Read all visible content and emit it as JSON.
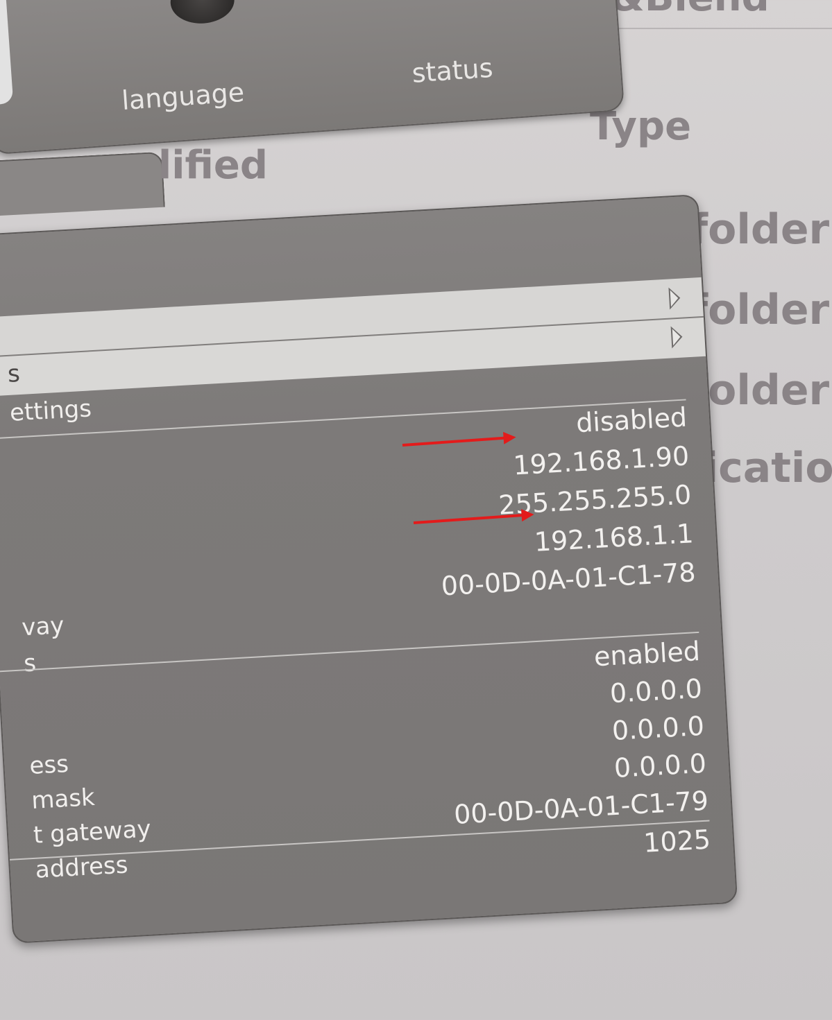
{
  "background_window": {
    "heading_fragment": "&Blend",
    "column_type": "Type",
    "column_modified_fragment": "lified",
    "type_values": [
      "folder",
      "folder",
      "folder",
      "licatio"
    ]
  },
  "top_panel": {
    "items": [
      {
        "label": "language",
        "icon": "knob-icon"
      },
      {
        "label": "status",
        "icon": "status-icon"
      }
    ]
  },
  "menu": {
    "rows": [
      {
        "label": "",
        "has_submenu": true,
        "highlighted": true
      },
      {
        "label": "s",
        "has_submenu": true,
        "highlighted": true
      },
      {
        "label": "ettings"
      }
    ]
  },
  "section1": {
    "labels": [
      "",
      "",
      "",
      "",
      "vay",
      "s"
    ],
    "values": [
      "disabled",
      "192.168.1.90",
      "255.255.255.0",
      "192.168.1.1",
      "00-0D-0A-01-C1-78"
    ]
  },
  "section2": {
    "labels": [
      "",
      "",
      "ess",
      "mask",
      "t gateway",
      "address"
    ],
    "values": [
      "enabled",
      "0.0.0.0",
      "0.0.0.0",
      "0.0.0.0",
      "00-0D-0A-01-C1-79"
    ]
  },
  "section3": {
    "values": [
      "1025"
    ]
  },
  "colors": {
    "panel": "#7d7a79",
    "highlight": "#d7d6d4",
    "text": "#f3f1ef",
    "annotation": "#e31b1b"
  }
}
